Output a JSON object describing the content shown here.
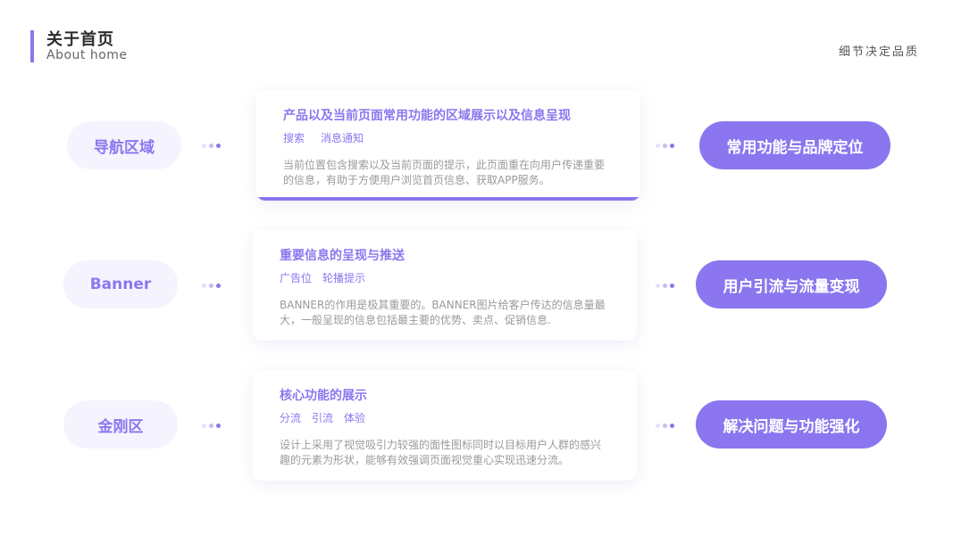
{
  "header": {
    "title": "关于首页",
    "subtitle": "About home",
    "slogan": "细节决定品质"
  },
  "rows": [
    {
      "left_label": "导航区域",
      "card": {
        "title": "产品以及当前页面常用功能的区域展示以及信息呈现",
        "tags": [
          "搜索",
          "消息通知"
        ],
        "description": "当前位置包含搜索以及当前页面的提示，此页面重在向用户传递重要的信息，有助于方便用户浏览首页信息、获取APP服务。"
      },
      "right_label": "常用功能与品牌定位"
    },
    {
      "left_label": "Banner",
      "card": {
        "title": "重要信息的呈现与推送",
        "tags": [
          "广告位",
          "轮播提示"
        ],
        "description": "BANNER的作用是极其重要的。BANNER图片给客户传达的信息量最大，一般呈现的信息包括最主要的优势、卖点、促销信息."
      },
      "right_label": "用户引流与流量变现"
    },
    {
      "left_label": "金刚区",
      "card": {
        "title": "核心功能的展示",
        "tags": [
          "分流",
          "引流",
          "体验"
        ],
        "description": "设计上采用了视觉吸引力较强的面性图标同时以目标用户人群的感兴趣的元素为形状，能够有效强调页面视觉重心实现迅速分流。"
      },
      "right_label": "解决问题与功能强化"
    }
  ],
  "colors": {
    "accent": "#8c76ef",
    "pill_bg_light": "#f5f3fe",
    "text_muted": "#9a9a9a"
  }
}
